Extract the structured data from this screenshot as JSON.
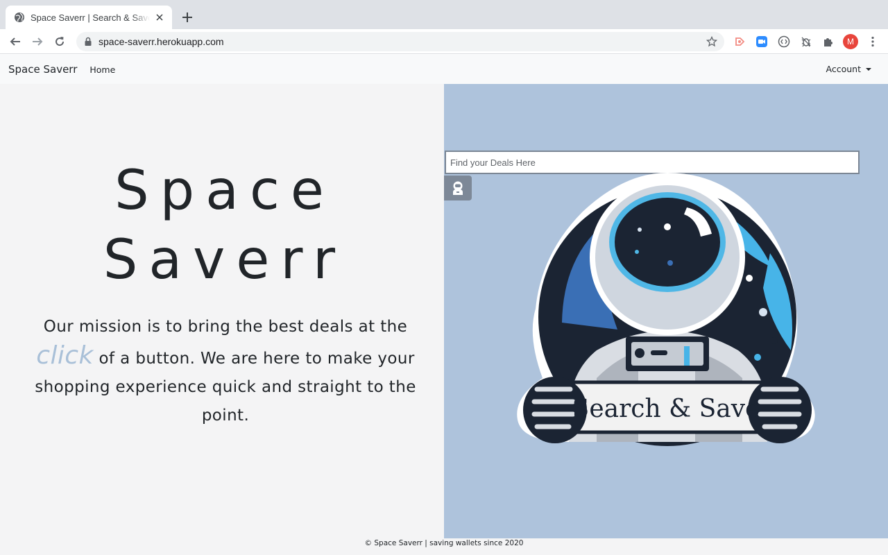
{
  "browser": {
    "tab_title": "Space Saverr | Search & Save",
    "url": "space-saverr.herokuapp.com",
    "profile_initial": "M"
  },
  "navbar": {
    "brand": "Space Saverr",
    "home": "Home",
    "account": "Account"
  },
  "hero": {
    "title_line1": "Space",
    "title_line2": "Saverr",
    "mission_part1": "Our mission is to bring the best deals at the ",
    "mission_click": "click",
    "mission_part2": " of a button. We are here to make your shopping experience quick and straight to the point."
  },
  "search": {
    "placeholder": "Find your Deals Here"
  },
  "logo": {
    "text": "Search & Save"
  },
  "footer": {
    "text": "© Space Saverr | saving wallets since 2020"
  },
  "colors": {
    "left_bg": "#f4f4f5",
    "right_bg": "#aec3dc",
    "click_accent": "#a9c0d8",
    "navbar_bg": "#f8f9fa"
  }
}
